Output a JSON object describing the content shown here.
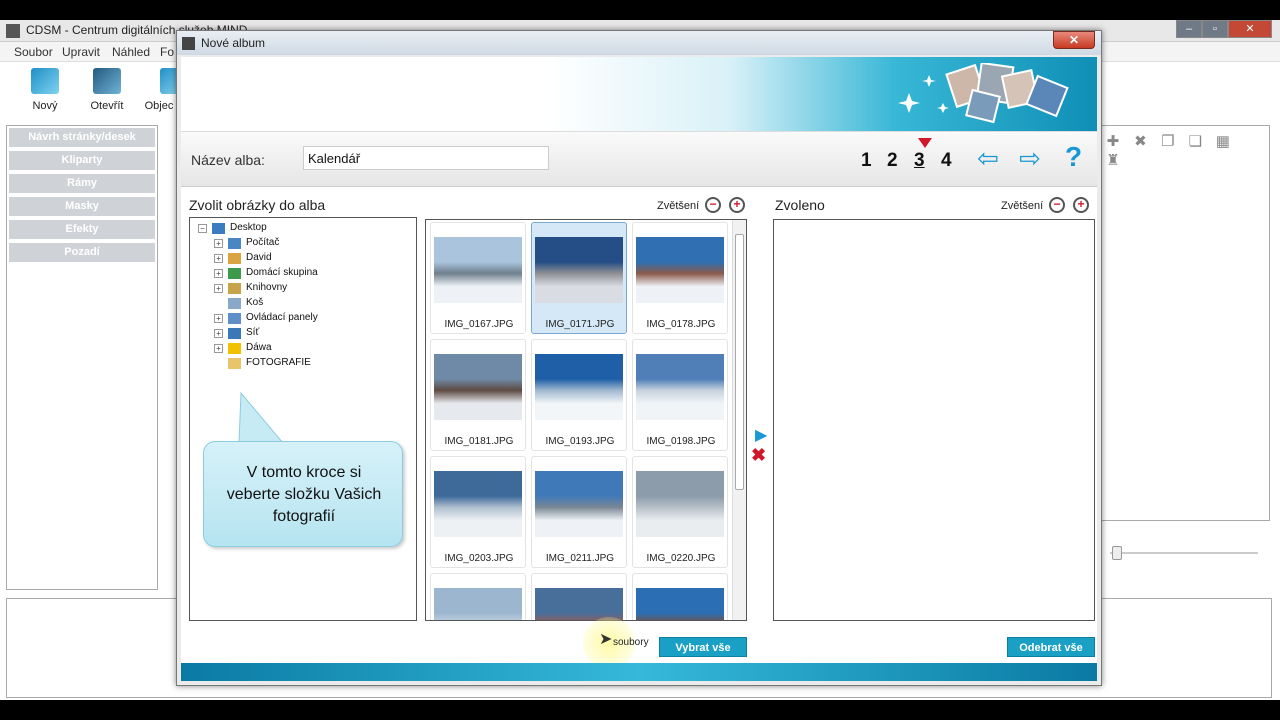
{
  "app": {
    "title": "CDSM - Centrum digitálních služeb MIND",
    "min_label": "–",
    "max_label": "▫",
    "close_label": "✕"
  },
  "menu": [
    "Soubor",
    "Upravit",
    "Náhled",
    "Fo"
  ],
  "toolbar": [
    {
      "label": "Nový",
      "icon": "new-document-icon"
    },
    {
      "label": "Otevřít",
      "icon": "open-folder-icon"
    },
    {
      "label": "Objec",
      "icon": "cart-icon"
    }
  ],
  "left_panel": [
    "Návrh stránky/desek",
    "Kliparty",
    "Rámy",
    "Masky",
    "Efekty",
    "Pozadí"
  ],
  "dialog": {
    "title": "Nové album",
    "close_label": "✕",
    "name_label": "Název alba:",
    "name_value": "Kalendář",
    "steps": [
      "1",
      "2",
      "3",
      "4"
    ],
    "current_step": 3,
    "help_label": "?",
    "left_section_title": "Zvolit obrázky do alba",
    "zoom_label": "Zvětšení",
    "right_section_title": "Zvoleno",
    "tree": [
      {
        "label": "Desktop",
        "level": 0,
        "expander": "⊟",
        "icon": "desktop-icon"
      },
      {
        "label": "Počítač",
        "level": 1,
        "expander": "⊞",
        "icon": "computer-icon"
      },
      {
        "label": "David",
        "level": 1,
        "expander": "⊞",
        "icon": "user-icon"
      },
      {
        "label": "Domácí skupina",
        "level": 1,
        "expander": "⊞",
        "icon": "homegroup-icon"
      },
      {
        "label": "Knihovny",
        "level": 1,
        "expander": "⊞",
        "icon": "library-icon"
      },
      {
        "label": "Koš",
        "level": 1,
        "expander": "",
        "icon": "recycle-bin-icon"
      },
      {
        "label": "Ovládací panely",
        "level": 1,
        "expander": "⊞",
        "icon": "control-panel-icon"
      },
      {
        "label": "Síť",
        "level": 1,
        "expander": "⊞",
        "icon": "network-icon"
      },
      {
        "label": "Dáwa",
        "level": 1,
        "expander": "⊞",
        "icon": "warning-icon"
      },
      {
        "label": "FOTOGRAFIE",
        "level": 1,
        "expander": "",
        "icon": "folder-icon"
      }
    ],
    "callout_lines": [
      "V tomto kroce si",
      "veberte složku Vašich",
      "fotografií"
    ],
    "thumbnails": [
      {
        "name": "IMG_0167.JPG",
        "selected": false,
        "colors": [
          "#a9c4dc",
          "#6f7f8c",
          "#eef2f6"
        ]
      },
      {
        "name": "IMG_0171.JPG",
        "selected": true,
        "colors": [
          "#254e86",
          "#8e8f94",
          "#d9dde3"
        ]
      },
      {
        "name": "IMG_0178.JPG",
        "selected": false,
        "colors": [
          "#2f6fb2",
          "#8a5a4a",
          "#eef2f6"
        ]
      },
      {
        "name": "IMG_0181.JPG",
        "selected": false,
        "colors": [
          "#6f8aa6",
          "#5d4b42",
          "#e6e9ee"
        ]
      },
      {
        "name": "IMG_0193.JPG",
        "selected": false,
        "colors": [
          "#1f5fa8",
          "#9fb7cf",
          "#f3f6f9"
        ]
      },
      {
        "name": "IMG_0198.JPG",
        "selected": false,
        "colors": [
          "#4f7fb6",
          "#c6d2de",
          "#f1f4f7"
        ]
      },
      {
        "name": "IMG_0203.JPG",
        "selected": false,
        "colors": [
          "#3d6a99",
          "#aebfcf",
          "#eef1f4"
        ]
      },
      {
        "name": "IMG_0211.JPG",
        "selected": false,
        "colors": [
          "#3f79b8",
          "#7a8794",
          "#eef2f6"
        ]
      },
      {
        "name": "IMG_0220.JPG",
        "selected": false,
        "colors": [
          "#8d9cab",
          "#b7c0c8",
          "#e9edf0"
        ]
      },
      {
        "name": "",
        "selected": false,
        "colors": [
          "#9cb6cf",
          "#c9d6e2",
          "#eef2f6"
        ]
      },
      {
        "name": "",
        "selected": false,
        "colors": [
          "#486e9a",
          "#a05b4d",
          "#eceff2"
        ]
      },
      {
        "name": "",
        "selected": false,
        "colors": [
          "#2b6eb4",
          "#7b4f3b",
          "#d9dfe5"
        ]
      }
    ],
    "files_label": "soubory",
    "select_all_label": "Vybrat vše",
    "remove_all_label": "Odebrat vše"
  },
  "colors": {
    "accent": "#1aa0c4",
    "step_marker": "#d0182a",
    "help": "#1a98d4"
  }
}
